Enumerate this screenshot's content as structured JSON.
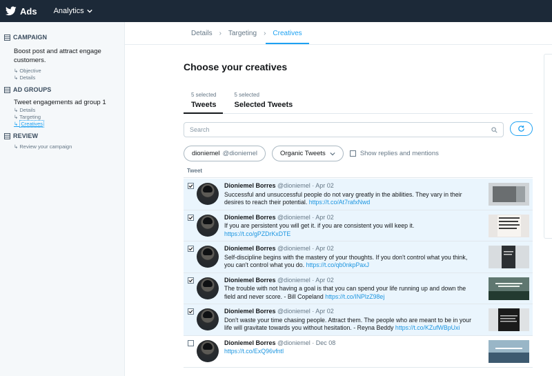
{
  "topbar": {
    "brand": "Ads",
    "menu": "Analytics"
  },
  "sidebar": {
    "campaign": {
      "heading": "CAMPAIGN",
      "title": "Boost post and attract engage customers.",
      "subs": [
        "Objective",
        "Details"
      ]
    },
    "adgroups": {
      "heading": "AD GROUPS",
      "title": "Tweet engagements ad group 1",
      "subs": [
        "Details",
        "Targeting",
        "Creatives"
      ]
    },
    "review": {
      "heading": "REVIEW",
      "subs": [
        "Review your campaign"
      ]
    }
  },
  "breadcrumb": [
    "Details",
    "Targeting",
    "Creatives"
  ],
  "page_title": "Choose your creatives",
  "tweet_tabs": [
    {
      "count": "5 selected",
      "label": "Tweets"
    },
    {
      "count": "5 selected",
      "label": "Selected Tweets"
    }
  ],
  "search": {
    "placeholder": "Search"
  },
  "filters": {
    "user_name": "dioniemel",
    "user_handle": "@dioniemel",
    "type": "Organic Tweets",
    "show_replies": "Show replies and mentions"
  },
  "table": {
    "column": "Tweet",
    "rows": [
      {
        "name": "Dioniemel Borres",
        "handle": "@dioniemel",
        "date": "Apr 02",
        "text": "Successful and unsuccessful people do not vary greatly in the abilities. They vary in their desires to reach their potential.",
        "link": "https://t.co/At7rafxNwd",
        "selected": true
      },
      {
        "name": "Dioniemel Borres",
        "handle": "@dioniemel",
        "date": "Apr 02",
        "text": "If you are persistent you will get it. if you are consistent you will keep it.",
        "link": "https://t.co/gPZDrKxDTE",
        "selected": true
      },
      {
        "name": "Dioniemel Borres",
        "handle": "@dioniemel",
        "date": "Apr 02",
        "text": "Self-discipline begins with the mastery of your thoughts. If you don't control what you think, you can't control what you do.",
        "link": "https://t.co/qb0nkpPaxJ",
        "selected": true
      },
      {
        "name": "Dioniemel Borres",
        "handle": "@dioniemel",
        "date": "Apr 02",
        "text": "The trouble with not having a goal is that you can spend your life running up and down the field and never score. - Bill Copeland",
        "link": "https://t.co/INPlzZ98ej",
        "selected": true
      },
      {
        "name": "Dioniemel Borres",
        "handle": "@dioniemel",
        "date": "Apr 02",
        "text": "Don't waste your time chasing people. Attract them. The people who are meant to be in your life will gravitate towards you without hesitation. - Reyna Beddy",
        "link": "https://t.co/KZufWBpUxi",
        "selected": true
      },
      {
        "name": "Dioniemel Borres",
        "handle": "@dioniemel",
        "date": "Dec 08",
        "text": "",
        "link": "https://t.co/ExQ96vfntl",
        "selected": false
      }
    ]
  },
  "colors": {
    "accent": "#1da1f2",
    "topbar": "#1c2938",
    "selected_row": "#eaf5fd"
  }
}
